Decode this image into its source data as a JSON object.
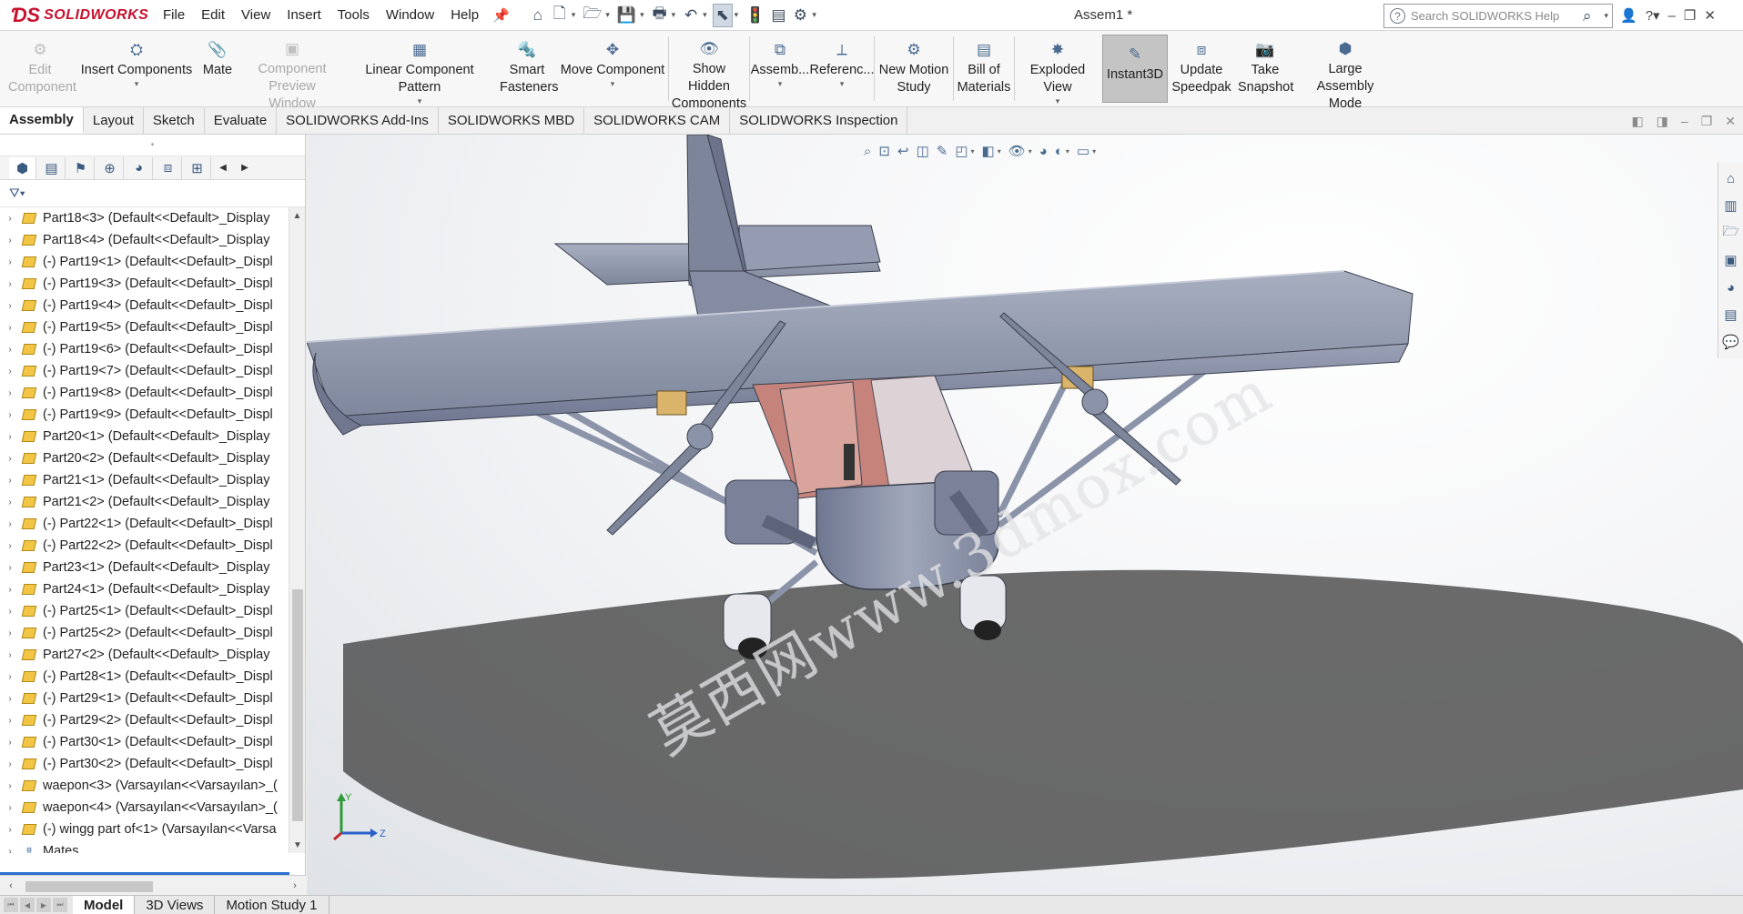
{
  "app": {
    "brand": "SOLIDWORKS",
    "document_title": "Assem1 *",
    "menus": [
      "File",
      "Edit",
      "View",
      "Insert",
      "Tools",
      "Window",
      "Help"
    ],
    "search_placeholder": "Search SOLIDWORKS Help"
  },
  "commands": {
    "edit_component": "Edit Component",
    "insert_components": "Insert Components",
    "mate": "Mate",
    "component_preview": "Component Preview Window",
    "linear_pattern": "Linear Component Pattern",
    "smart_fasteners": "Smart Fasteners",
    "move_component": "Move Component",
    "show_hidden": "Show Hidden Components",
    "assembly_features": "Assemb...",
    "reference_geometry": "Referenc...",
    "new_motion_study": "New Motion Study",
    "bill_of_materials": "Bill of Materials",
    "exploded_view": "Exploded View",
    "instant3d": "Instant3D",
    "update_speedpak": "Update Speedpak",
    "take_snapshot": "Take Snapshot",
    "large_assembly_mode": "Large Assembly Mode"
  },
  "tabs": [
    "Assembly",
    "Layout",
    "Sketch",
    "Evaluate",
    "SOLIDWORKS Add-Ins",
    "SOLIDWORKS MBD",
    "SOLIDWORKS CAM",
    "SOLIDWORKS Inspection"
  ],
  "tree": {
    "items": [
      "Part18<3> (Default<<Default>_Display",
      "Part18<4> (Default<<Default>_Display",
      "(-) Part19<1> (Default<<Default>_Displ",
      "(-) Part19<3> (Default<<Default>_Displ",
      "(-) Part19<4> (Default<<Default>_Displ",
      "(-) Part19<5> (Default<<Default>_Displ",
      "(-) Part19<6> (Default<<Default>_Displ",
      "(-) Part19<7> (Default<<Default>_Displ",
      "(-) Part19<8> (Default<<Default>_Displ",
      "(-) Part19<9> (Default<<Default>_Displ",
      "Part20<1> (Default<<Default>_Display",
      "Part20<2> (Default<<Default>_Display",
      "Part21<1> (Default<<Default>_Display",
      "Part21<2> (Default<<Default>_Display",
      "(-) Part22<1> (Default<<Default>_Displ",
      "(-) Part22<2> (Default<<Default>_Displ",
      "Part23<1> (Default<<Default>_Display",
      "Part24<1> (Default<<Default>_Display",
      "(-) Part25<1> (Default<<Default>_Displ",
      "(-) Part25<2> (Default<<Default>_Displ",
      "Part27<2> (Default<<Default>_Display",
      "(-) Part28<1> (Default<<Default>_Displ",
      "(-) Part29<1> (Default<<Default>_Displ",
      "(-) Part29<2> (Default<<Default>_Displ",
      "(-) Part30<1> (Default<<Default>_Displ",
      "(-) Part30<2> (Default<<Default>_Displ",
      "waepon<3> (Varsayılan<<Varsayılan>_(",
      "waepon<4> (Varsayılan<<Varsayılan>_(",
      "(-) wingg part of<1> (Varsayılan<<Varsa"
    ],
    "mates_label": "Mates"
  },
  "viewport": {
    "watermark": "莫西网www.3dmox.com",
    "triad_x": "Z",
    "triad_y": "Y"
  },
  "bottom_tabs": [
    "Model",
    "3D Views",
    "Motion Study 1"
  ],
  "colors": {
    "brand_red": "#c8102e",
    "accent_blue": "#2a6fd1",
    "model_gray": "#8b93a8",
    "cockpit_pink": "#d9a49b"
  }
}
